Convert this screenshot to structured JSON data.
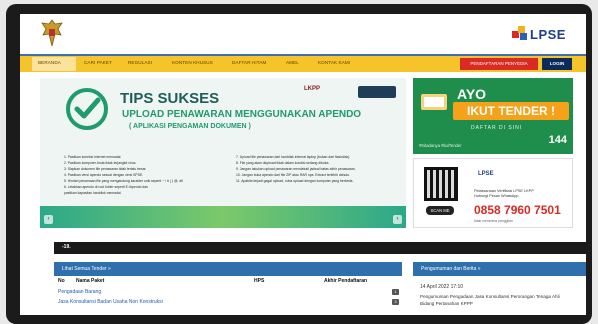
{
  "header": {
    "emblem_icon": "garuda-emblem-icon",
    "logo_text": "LPSE"
  },
  "nav": {
    "items": [
      "BERANDA",
      "CARI PAKET",
      "REGULASI",
      "KONTEN KHUSUS",
      "DAFTAR HITAM",
      "AMEL",
      "KONTAK KAMI"
    ],
    "red_button": "PENDAFTARAN PENYEDIA",
    "login": "LOGIN"
  },
  "hero": {
    "title": "TIPS SUKSES",
    "subtitle": "UPLOAD PENAWARAN MENGGUNAKAN APENDO",
    "subtitle2": "( APLIKASI PENGAMAN DOKUMEN )",
    "lkpp": "LKPP",
    "tips_left": [
      "1. Pastikan koneksi internet memadai.",
      "2. Pastikan komputer Anda tidak terjangkit virus.",
      "3. Siapkan dokumen file penawaran tidak terlalu besar.",
      "4. Pastikan versi apendo sesuai dengan versi SPSE.",
      "5. Hindari penamaan file yang mengandung karakter unik seperti ~ ! # ( ) @, dll",
      "6. Letakkan apendo di root folder seperti E:/Apendo dan",
      "   pastikan kapasitas harddisk memadai."
    ],
    "tips_right": [
      "7. Upload file penawaran dari harddisk internal laptop (bukan dari flashdisk).",
      "8. File yang akan diupload tidak dalam kondisi sedang dibuka.",
      "9. Jangan lakukan upload penawaran mendekati jadwal batas akhir penawaran.",
      "10. Jangan buka apendo dari file ZIP atau RAR nya. Extract terlebih dahulu.",
      "11. Apabila terjadi gagal upload, coba upload dengan komputer yang berbeda."
    ]
  },
  "promo1": {
    "ayo": "AYO",
    "ikut": "IKUT TENDER !",
    "daftar": "DAFTAR DI SINI",
    "hashtag": "#Kitadanya #kuiTender",
    "number": "144"
  },
  "promo2": {
    "scan": "SCAN ME",
    "logo": "LPSE",
    "line1": "Pelaksanaan Verifikasi LPSE LKPP",
    "line2": "Hubungi Pesan WhatsApp",
    "phone": "0858 7960 7501",
    "note": "tidak menerima panggilan"
  },
  "ticker": {
    "text": "-19."
  },
  "tender": {
    "header": "Lihat Semua Tender »",
    "columns": [
      "No",
      "Nama Paket",
      "HPS",
      "Akhir Pendaftaran"
    ],
    "rows": [
      {
        "name": "Pengadaan Barang",
        "badge": "1"
      },
      {
        "name": "Jasa Konsultansi Badan Usaha Non Konstruksi",
        "badge": "3"
      }
    ]
  },
  "news": {
    "header": "Pengumuman dan Berita »",
    "date": "14 April 2022 17:10",
    "text": "Pengumuman Pengadaan Jasa Konsultansi Perorangan Tenaga Ahli Bidang Pertanahan KPPP"
  }
}
